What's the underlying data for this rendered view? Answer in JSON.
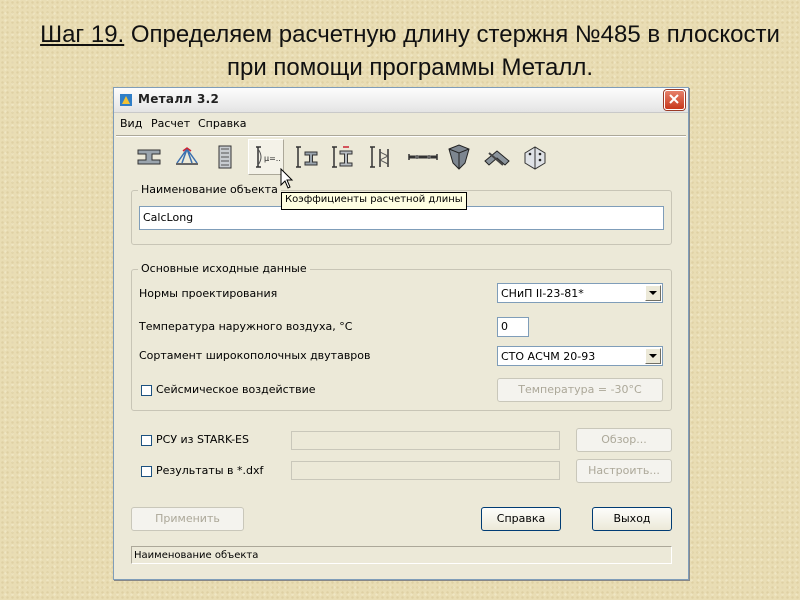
{
  "slide": {
    "title_step": "Шаг 19.",
    "title_rest": " Определяем расчетную длину стержня №485 в плоскости при помощи программы Металл."
  },
  "window": {
    "title": "Металл 3.2",
    "menu": [
      "Вид",
      "Расчет",
      "Справка"
    ],
    "toolbar": [
      {
        "icon": "ibeam-section-icon"
      },
      {
        "icon": "truss-node-icon"
      },
      {
        "icon": "column-base-plate-icon"
      },
      {
        "icon": "effective-length-coefficient-icon",
        "active": true
      },
      {
        "icon": "column-section-icon"
      },
      {
        "icon": "beam-column-icon"
      },
      {
        "icon": "lattice-column-icon"
      },
      {
        "icon": "bolt-connection-icon"
      },
      {
        "icon": "bunker-icon"
      },
      {
        "icon": "truss-joint-icon"
      },
      {
        "icon": "flange-connection-icon"
      }
    ],
    "tooltip": "Коэффициенты расчетной длины",
    "object_group": {
      "legend": "Наименование объекта",
      "value": "CalcLong"
    },
    "main_group": {
      "legend": "Основные исходные данные",
      "design_norms_label": "Нормы проектирования",
      "design_norms_value": "СНиП II-23-81*",
      "temperature_label": "Температура наружного воздуха, °C",
      "temperature_value": "0",
      "assortment_label": "Сортамент широкополочных двутавров",
      "assortment_value": "СТО АСЧМ 20-93",
      "seismic_label": "Сейсмическое воздействие",
      "seismic_checked": false,
      "temperature_button": "Температура = -30°C"
    },
    "rsu_label": "РСУ из STARK-ES",
    "rsu_path": "",
    "browse_button": "Обзор...",
    "dxf_label": "Результаты в *.dxf",
    "dxf_path": "",
    "configure_button": "Настроить...",
    "apply_button": "Применить",
    "help_button": "Справка",
    "exit_button": "Выход",
    "status_text": "Наименование объекта"
  }
}
